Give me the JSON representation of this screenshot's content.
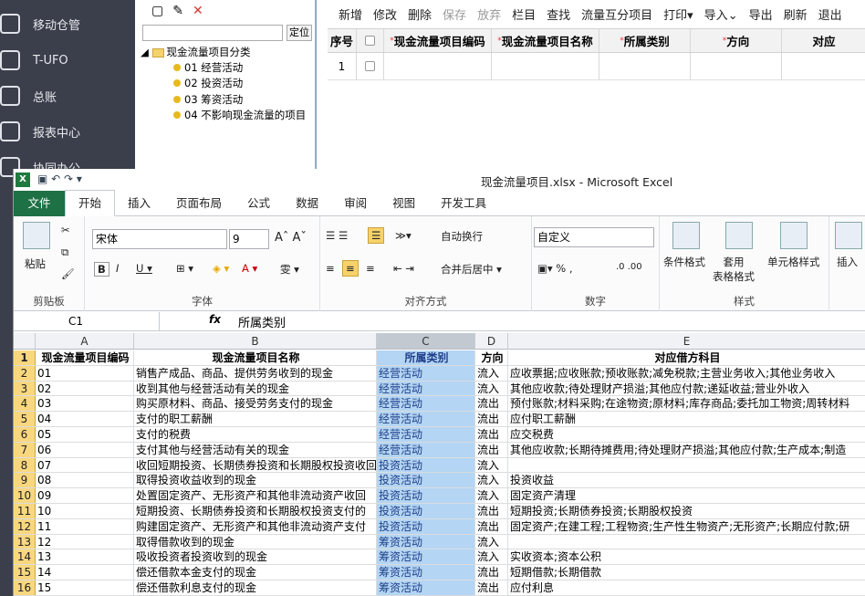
{
  "sidebar": {
    "items": [
      {
        "label": "移动仓管"
      },
      {
        "label": "T-UFO"
      },
      {
        "label": "总账"
      },
      {
        "label": "报表中心"
      },
      {
        "label": "协同办公"
      }
    ]
  },
  "tree": {
    "locate_label": "定位",
    "root": "现金流量项目分类",
    "nodes": [
      "01 经营活动",
      "02 投资活动",
      "03 筹资活动",
      "04 不影响现金流量的项目"
    ]
  },
  "toolbar": {
    "buttons": [
      "新增",
      "修改",
      "删除",
      "保存",
      "放弃",
      "栏目",
      "查找",
      "流量互分项目",
      "打印",
      "导入",
      "导出",
      "刷新",
      "退出"
    ]
  },
  "grid": {
    "headers": [
      "序号",
      "",
      "现金流量项目编码",
      "现金流量项目名称",
      "所属类别",
      "方向",
      "对应"
    ],
    "rows": [
      {
        "no": "1"
      }
    ]
  },
  "excel": {
    "title": "现金流量项目.xlsx - Microsoft Excel",
    "tabs": [
      "文件",
      "开始",
      "插入",
      "页面布局",
      "公式",
      "数据",
      "审阅",
      "视图",
      "开发工具"
    ],
    "ribbon": {
      "paste": "粘贴",
      "clipboard": "剪贴板",
      "font_name": "宋体",
      "font_size": "9",
      "font_group": "字体",
      "wrap": "自动换行",
      "merge": "合并后居中",
      "align_group": "对齐方式",
      "number_format": "自定义",
      "number_group": "数字",
      "cond_format": "条件格式",
      "table_format": "套用\n表格格式",
      "cell_style": "单元格样式",
      "style_group": "样式",
      "insert": "插入"
    },
    "namebox": "C1",
    "formula": "所属类别",
    "columns": [
      "A",
      "B",
      "C",
      "D",
      "E"
    ],
    "header_row": [
      "现金流量项目编码",
      "现金流量项目名称",
      "所属类别",
      "方向",
      "对应借方科目"
    ],
    "rows": [
      [
        "01",
        "销售产成品、商品、提供劳务收到的现金",
        "经营活动",
        "流入",
        "应收票据;应收账款;预收账款;减免税款;主营业务收入;其他业务收入"
      ],
      [
        "02",
        "收到其他与经营活动有关的现金",
        "经营活动",
        "流入",
        "其他应收款;待处理财产损溢;其他应付款;递延收益;营业外收入"
      ],
      [
        "03",
        "购买原材料、商品、接受劳务支付的现金",
        "经营活动",
        "流出",
        "预付账款;材料采购;在途物资;原材料;库存商品;委托加工物资;周转材料"
      ],
      [
        "04",
        "支付的职工薪酬",
        "经营活动",
        "流出",
        "应付职工薪酬"
      ],
      [
        "05",
        "支付的税费",
        "经营活动",
        "流出",
        "应交税费"
      ],
      [
        "06",
        "支付其他与经营活动有关的现金",
        "经营活动",
        "流出",
        "其他应收款;长期待摊费用;待处理财产损溢;其他应付款;生产成本;制造"
      ],
      [
        "07",
        "收回短期投资、长期债券投资和长期股权投资收回",
        "投资活动",
        "流入",
        ""
      ],
      [
        "08",
        "取得投资收益收到的现金",
        "投资活动",
        "流入",
        "投资收益"
      ],
      [
        "09",
        "处置固定资产、无形资产和其他非流动资产收回",
        "投资活动",
        "流入",
        "固定资产清理"
      ],
      [
        "10",
        "短期投资、长期债券投资和长期股权投资支付的",
        "投资活动",
        "流出",
        "短期投资;长期债券投资;长期股权投资"
      ],
      [
        "11",
        "购建固定资产、无形资产和其他非流动资产支付",
        "投资活动",
        "流出",
        "固定资产;在建工程;工程物资;生产性生物资产;无形资产;长期应付款;研"
      ],
      [
        "12",
        "取得借款收到的现金",
        "筹资活动",
        "流入",
        ""
      ],
      [
        "13",
        "吸收投资者投资收到的现金",
        "筹资活动",
        "流入",
        "实收资本;资本公积"
      ],
      [
        "14",
        "偿还借款本金支付的现金",
        "筹资活动",
        "流出",
        "短期借款;长期借款"
      ],
      [
        "15",
        "偿还借款利息支付的现金",
        "筹资活动",
        "流出",
        "应付利息"
      ]
    ]
  }
}
